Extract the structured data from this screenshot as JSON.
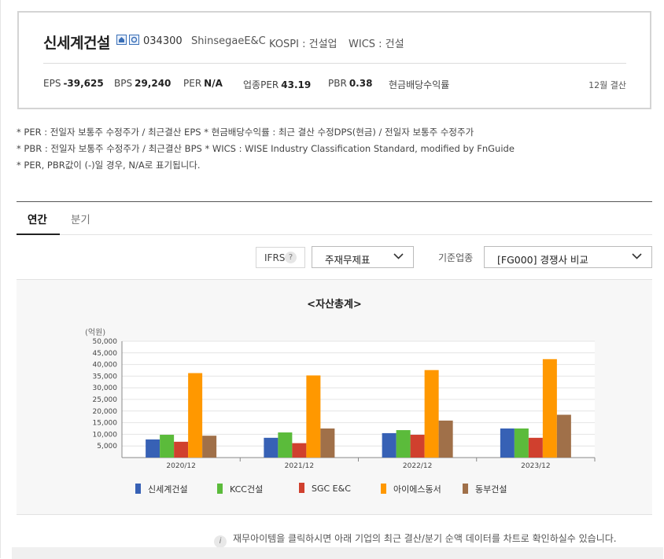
{
  "company": {
    "name": "신세계건설",
    "code": "034300",
    "english_name": "ShinsegaeE&C",
    "market": "KOSPI : 건설업",
    "wics": "WICS : 건설"
  },
  "stats": [
    {
      "label": "EPS",
      "value": "-39,625"
    },
    {
      "label": "BPS",
      "value": "29,240"
    },
    {
      "label": "PER",
      "value": "N/A"
    },
    {
      "label": "업종PER",
      "value": "43.19"
    },
    {
      "label": "PBR",
      "value": "0.38"
    },
    {
      "label": "현금배당수익률",
      "value": ""
    }
  ],
  "settlement": "12월 결산",
  "notes": [
    "* PER : 전일자 보통주 수정주가 / 최근결산 EPS * 현금배당수익률 : 최근 결산 수정DPS(현금) / 전일자 보통주 수정주가",
    "* PBR : 전일자 보통주 수정주가 / 최근결산 BPS * WICS : WISE Industry Classification Standard, modified by FnGuide",
    "* PER, PBR값이 (-)일 경우, N/A로 표기됩니다."
  ],
  "tabs": [
    {
      "label": "연간"
    },
    {
      "label": "분기"
    }
  ],
  "controls": {
    "ifrs_label": "IFRS",
    "help": "?",
    "report_select": "주재무제표",
    "industry_label": "기준업종",
    "industry_select": "[FG000] 경쟁사 비교"
  },
  "colors": {
    "series": [
      "#3761b5",
      "#5bbb3b",
      "#d0402e",
      "#ff9800",
      "#a07049"
    ]
  },
  "chart_data": {
    "type": "bar",
    "title": "<자산총계>",
    "ylabel": "(억원)",
    "ylim": [
      0,
      50000
    ],
    "yticks": [
      5000,
      10000,
      15000,
      20000,
      25000,
      30000,
      35000,
      40000,
      45000,
      50000
    ],
    "ytick_labels": [
      "5,000",
      "10,000",
      "15,000",
      "20,000",
      "25,000",
      "30,000",
      "35,000",
      "40,000",
      "45,000",
      "50,000"
    ],
    "grid": true,
    "legend_position": "bottom",
    "categories": [
      "2020/12",
      "2021/12",
      "2022/12",
      "2023/12"
    ],
    "series": [
      {
        "name": "신세계건설",
        "values": [
          7800,
          8500,
          10500,
          12500
        ]
      },
      {
        "name": "KCC건설",
        "values": [
          9800,
          10800,
          11800,
          12500
        ]
      },
      {
        "name": "SGC E&C",
        "values": [
          6800,
          6200,
          9800,
          8500
        ]
      },
      {
        "name": "아이에스동서",
        "values": [
          36300,
          35300,
          37600,
          42300
        ]
      },
      {
        "name": "동부건설",
        "values": [
          9400,
          12500,
          15900,
          18400
        ]
      }
    ]
  },
  "info_text": "재무아이템을 클릭하시면 아래 기업의 최근 결산/분기 순액 데이터를 차트로 확인하실수 있습니다."
}
